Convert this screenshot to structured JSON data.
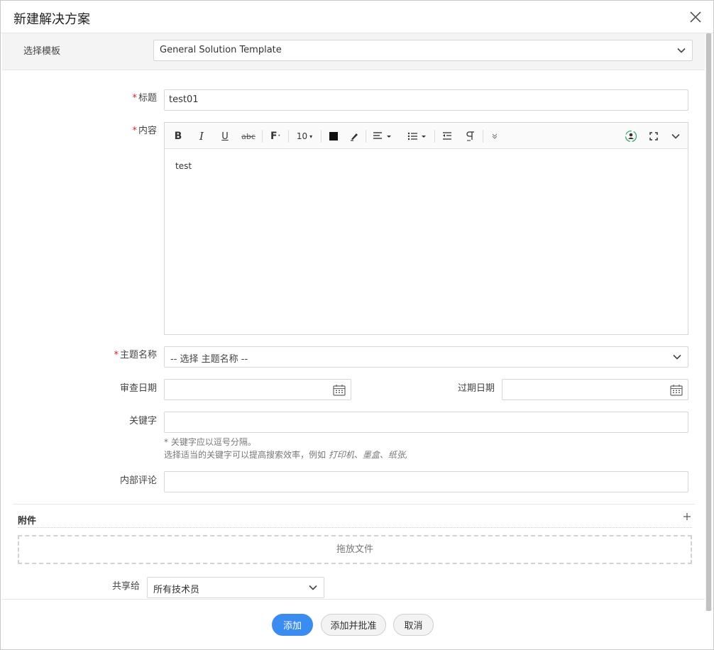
{
  "dialog": {
    "title": "新建解决方案",
    "close_label": "×"
  },
  "template": {
    "label": "选择模板",
    "value": "General Solution Template"
  },
  "form": {
    "title_label": "标题",
    "title_value": "test01",
    "content_label": "内容",
    "content_text": "test",
    "subject_label": "主题名称",
    "subject_placeholder": "-- 选择 主题名称 --",
    "review_date_label": "审查日期",
    "review_date_value": "",
    "expiry_date_label": "过期日期",
    "expiry_date_value": "",
    "keywords_label": "关键字",
    "keywords_value": "",
    "keywords_hint_line1": "* 关键字应以逗号分隔。",
    "keywords_hint_line2_prefix": "选择适当的关键字可以提高搜索效率，例如 ",
    "keywords_hint_examples": "打印机、墨盒、纸张,",
    "internal_comment_label": "内部评论",
    "internal_comment_value": "",
    "required_mark": "*"
  },
  "toolbar": {
    "font_size": "10",
    "font_label": "F"
  },
  "attachment": {
    "title": "附件",
    "dropzone_text": "拖放文件"
  },
  "share": {
    "label": "共享给",
    "value": "所有技术员"
  },
  "footer": {
    "add_label": "添加",
    "add_approve_label": "添加并批准",
    "cancel_label": "取消"
  },
  "colors": {
    "primary": "#3b8cf0",
    "required": "#e02020"
  }
}
